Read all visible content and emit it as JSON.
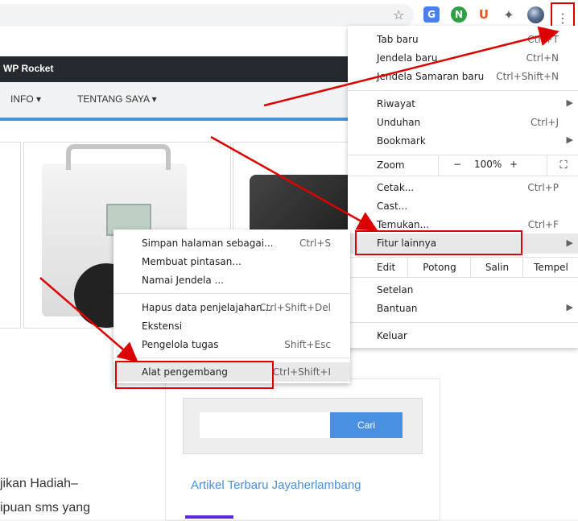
{
  "toolbar": {
    "icons": [
      "star-icon",
      "translate-icon",
      "n-extension-icon",
      "u-extension-icon",
      "puzzle-icon",
      "avatar",
      "kebab-menu-icon"
    ],
    "ext_n_label": "N",
    "ext_u_label": "U",
    "kebab_glyph": "⋮",
    "star_glyph": "☆",
    "puzzle_glyph": "✦"
  },
  "site": {
    "brand": "WP Rocket",
    "nav": [
      "INFO ▾",
      "TENTANG SAYA ▾"
    ],
    "search_button": "Cari",
    "sidebar_heading": "Artikel Terbaru Jayaherlambang",
    "body_lines": [
      "jikan Hadiah–",
      "ipuan sms yang"
    ],
    "accent": "#4a90d9",
    "brandbar_color": "#252a2e"
  },
  "menu": {
    "group1": [
      {
        "label": "Tab baru",
        "shortcut": "Ctrl+T"
      },
      {
        "label": "Jendela baru",
        "shortcut": "Ctrl+N"
      },
      {
        "label": "Jendela Samaran baru",
        "shortcut": "Ctrl+Shift+N"
      }
    ],
    "group2": [
      {
        "label": "Riwayat",
        "shortcut": "",
        "arrow": "▶"
      },
      {
        "label": "Unduhan",
        "shortcut": "Ctrl+J"
      },
      {
        "label": "Bookmark",
        "shortcut": "",
        "arrow": "▶"
      }
    ],
    "zoom": {
      "label": "Zoom",
      "minus": "−",
      "value": "100%",
      "plus": "+",
      "fullscreen": "⛶"
    },
    "group3": [
      {
        "label": "Cetak...",
        "shortcut": "Ctrl+P"
      },
      {
        "label": "Cast...",
        "shortcut": ""
      },
      {
        "label": "Temukan...",
        "shortcut": "Ctrl+F"
      },
      {
        "label": "Fitur lainnya",
        "shortcut": "",
        "arrow": "▶"
      }
    ],
    "edit": {
      "label": "Edit",
      "cut": "Potong",
      "copy": "Salin",
      "paste": "Tempel"
    },
    "group4": [
      {
        "label": "Setelan",
        "shortcut": ""
      },
      {
        "label": "Bantuan",
        "shortcut": "",
        "arrow": "▶"
      }
    ],
    "exit": {
      "label": "Keluar"
    }
  },
  "submenu": {
    "group1": [
      {
        "label": "Simpan halaman sebagai...",
        "shortcut": "Ctrl+S"
      },
      {
        "label": "Membuat pintasan...",
        "shortcut": ""
      },
      {
        "label": "Namai Jendela ...",
        "shortcut": ""
      }
    ],
    "group2": [
      {
        "label": "Hapus data penjelajahan...",
        "shortcut": "Ctrl+Shift+Del"
      },
      {
        "label": "Ekstensi",
        "shortcut": ""
      },
      {
        "label": "Pengelola tugas",
        "shortcut": "Shift+Esc"
      }
    ],
    "devtools": {
      "label": "Alat pengembang",
      "shortcut": "Ctrl+Shift+I"
    }
  },
  "colors": {
    "annotation_red": "#dd0000",
    "highlight": "#e8e8e8"
  }
}
